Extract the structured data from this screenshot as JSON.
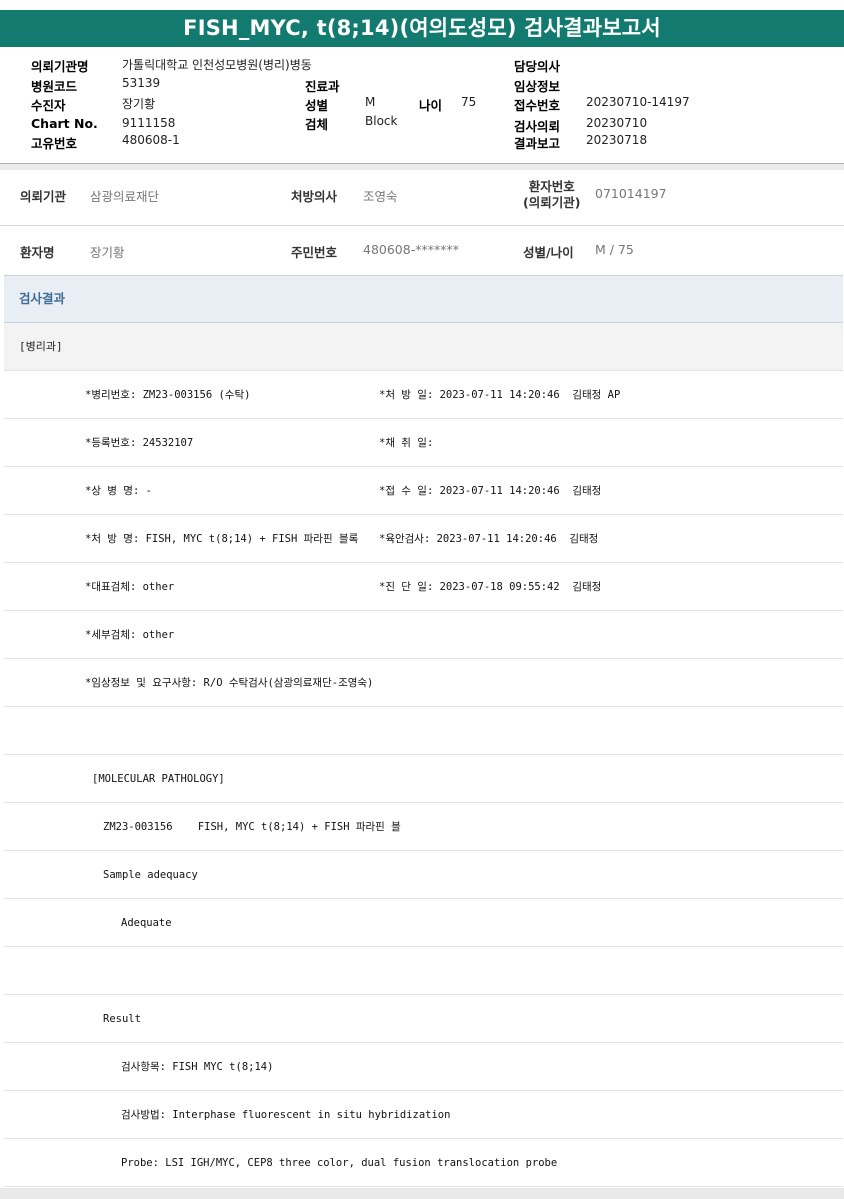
{
  "title": "FISH_MYC, t(8;14)(여의도성모) 검사결과보고서",
  "header": {
    "left": [
      {
        "label": "의뢰기관명",
        "value": "가톨릭대학교 인천성모병원(병리)병동"
      },
      {
        "label": "병원코드",
        "value": "53139"
      },
      {
        "label": "수진자",
        "value": "장기황"
      },
      {
        "label": "Chart No.",
        "value": "9111158"
      },
      {
        "label": "고유번호",
        "value": "480608-1"
      }
    ],
    "middle": [
      {
        "label": "진료과",
        "value": ""
      },
      {
        "label": "성별",
        "value": "M"
      },
      {
        "label": "검체",
        "value": "Block"
      }
    ],
    "age": {
      "label": "나이",
      "value": "75"
    },
    "right": [
      {
        "label": "담당의사",
        "value": ""
      },
      {
        "label": "임상정보",
        "value": ""
      },
      {
        "label": "접수번호",
        "value": "20230710-14197"
      },
      {
        "label": "검사의뢰",
        "value": "20230710"
      },
      {
        "label": "결과보고",
        "value": "20230718"
      }
    ]
  },
  "info": {
    "row1": [
      {
        "label": "의뢰기관",
        "value": "삼광의료재단"
      },
      {
        "label": "처방의사",
        "value": "조영숙"
      },
      {
        "label": "환자번호\n(의뢰기관)",
        "value": "071014197"
      }
    ],
    "row2": [
      {
        "label": "환자명",
        "value": "장기황"
      },
      {
        "label": "주민번호",
        "value": "480608-*******"
      },
      {
        "label": "성별/나이",
        "value": "M / 75"
      }
    ]
  },
  "section_title": "검사결과",
  "dept": "[병리과]",
  "report_rows": [
    {
      "left": "*병리번호: ZM23-003156 (수탁)",
      "right": "*처 방 일: 2023-07-11 14:20:46  김태정 AP"
    },
    {
      "left": "*등록번호: 24532107",
      "right": "*채 취 일:"
    },
    {
      "left": "*상 병 명: -",
      "right": "*접 수 일: 2023-07-11 14:20:46  김태정"
    },
    {
      "left": "*처 방 명: FISH, MYC t(8;14) + FISH 파라핀 블록",
      "right": "*육안검사: 2023-07-11 14:20:46  김태정"
    },
    {
      "left": "*대표검체: other",
      "right": "*진 단 일: 2023-07-18 09:55:42  김태정"
    },
    {
      "left": "*세부검체: other",
      "right": ""
    },
    {
      "left": "*임상정보 및 요구사항: R/O 수탁검사(삼광의료재단-조영숙)",
      "right": ""
    }
  ],
  "detail_rows": [
    {
      "text": "",
      "indent": 0
    },
    {
      "text": "[MOLECULAR PATHOLOGY]",
      "indent": 1
    },
    {
      "text": "ZM23-003156    FISH, MYC t(8;14) + FISH 파라핀 블",
      "indent": 2
    },
    {
      "text": "Sample adequacy",
      "indent": 2
    },
    {
      "text": "Adequate",
      "indent": 3
    },
    {
      "text": "",
      "indent": 0
    },
    {
      "text": "Result",
      "indent": 2
    },
    {
      "text": "검사항목: FISH MYC t(8;14)",
      "indent": 3
    },
    {
      "text": "검사방법: Interphase fluorescent in situ hybridization",
      "indent": 3
    },
    {
      "text": "Probe: LSI IGH/MYC, CEP8 three color, dual fusion translocation probe",
      "indent": 3
    }
  ]
}
